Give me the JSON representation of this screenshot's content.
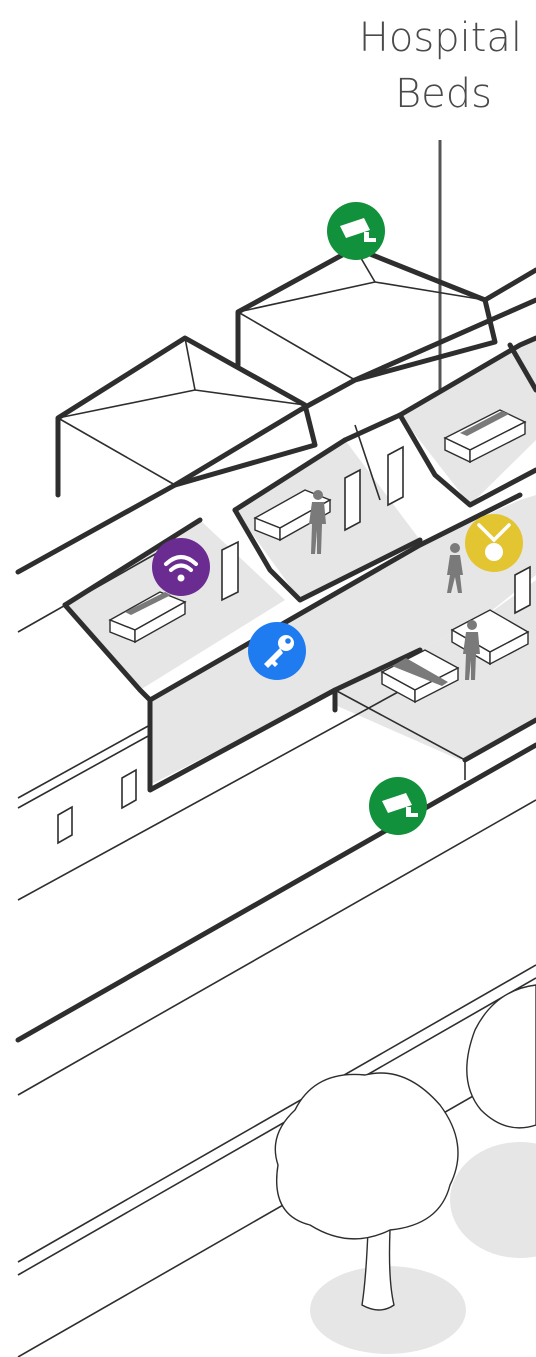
{
  "label": {
    "line1": "Hospital",
    "line2": "Beds"
  },
  "markers": [
    {
      "name": "security-camera-icon",
      "color": "#12913c"
    },
    {
      "name": "wifi-icon",
      "color": "#6a2c91"
    },
    {
      "name": "access-key-icon",
      "color": "#1e7bf0"
    },
    {
      "name": "nurse-call-pendant-icon",
      "color": "#e3c531"
    },
    {
      "name": "security-camera-icon",
      "color": "#12913c"
    }
  ]
}
